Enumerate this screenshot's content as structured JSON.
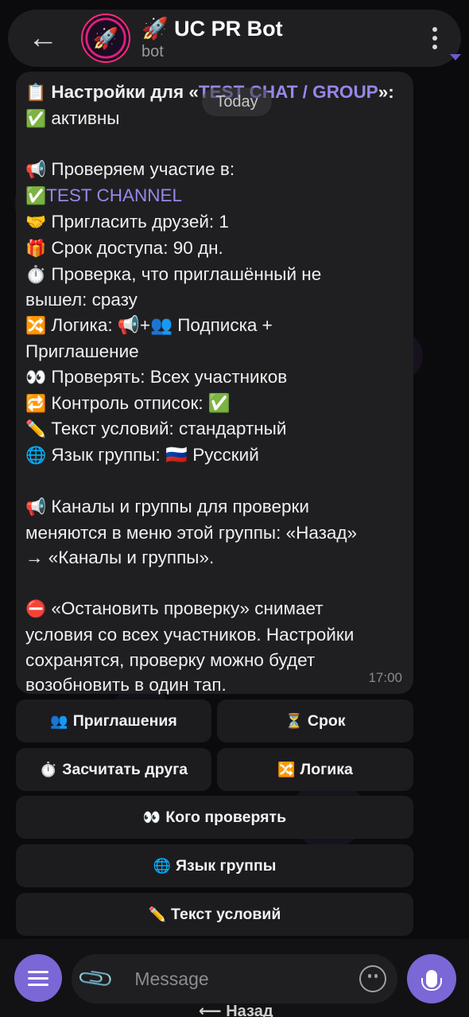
{
  "header": {
    "back_icon": "arrow-left-icon",
    "title": "🚀 UC PR Bot",
    "subtitle": "bot",
    "more_icon": "more-vertical-icon"
  },
  "date_pill": "Today",
  "message": {
    "l1_a": "Настройки для «",
    "l1_link": "TEST CHAT / GROUP",
    "l1_b": "»:",
    "l2": "активны",
    "l3": "Проверяем участие в:",
    "l4_link": "TEST CHANNEL",
    "l5": "Пригласить друзей: 1",
    "l6": "Срок доступа: 90 дн.",
    "l7": "Проверка, что приглашённый не",
    "l8": "вышел: сразу",
    "l9": "Логика: 📢+👥 Подписка +",
    "l10": "Приглашение",
    "l11": "Проверять: Всех участников",
    "l12": "Контроль отписок: ✅",
    "l13": "Текст условий: стандартный",
    "l14": "Язык группы: 🇷🇺 Русский",
    "l15": "Каналы и группы для проверки",
    "l16": "меняются в меню этой группы: «Назад»",
    "l17": "→ «Каналы и группы».",
    "l18": "«Остановить проверку» снимает",
    "l19": "условия со всех участников. Настройки",
    "l20": "сохранятся, проверку можно будет",
    "l21": "возобновить в один тап.",
    "time": "17:00"
  },
  "keyboard": {
    "invites": "Приглашения",
    "term": "Срок",
    "count_friend": "Засчитать друга",
    "logic": "Логика",
    "who_check": "Кого проверять",
    "group_lang": "Язык группы",
    "terms_text": "Текст условий",
    "back_peek": "Назад"
  },
  "input": {
    "placeholder": "Message"
  },
  "colors": {
    "accent": "#7b67d6",
    "link": "#9a86e8",
    "bubble": "#1f1f21"
  }
}
